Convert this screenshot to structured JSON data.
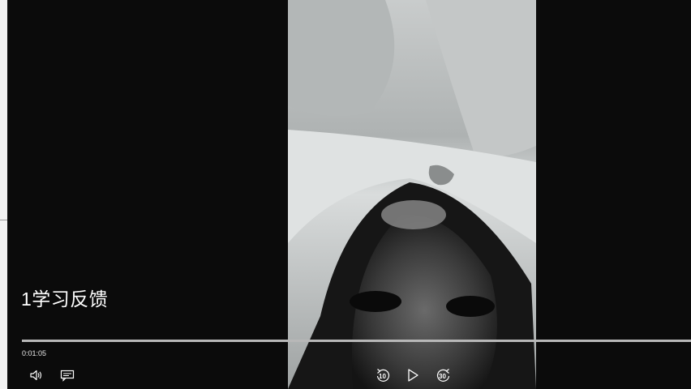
{
  "player": {
    "title": "1学习反馈",
    "current_time": "0:01:05",
    "progress_fraction": 1.0,
    "controls": {
      "volume_icon": "volume-icon",
      "captions_icon": "captions-icon",
      "skip_back": "10",
      "skip_forward": "30",
      "play_icon": "play-icon"
    }
  },
  "colors": {
    "background": "#0b0b0b",
    "text": "#ffffff",
    "progress_fill": "#b8b8b8",
    "progress_track": "#6e6e6e"
  }
}
